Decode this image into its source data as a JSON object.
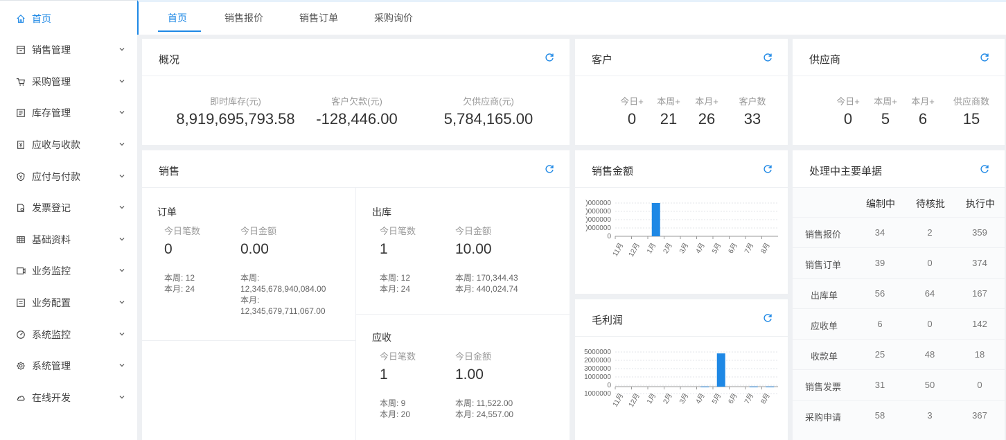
{
  "sidebar": {
    "items": [
      {
        "label": "首页",
        "icon": "home-icon"
      },
      {
        "label": "销售管理",
        "icon": "sales-icon"
      },
      {
        "label": "采购管理",
        "icon": "cart-icon"
      },
      {
        "label": "库存管理",
        "icon": "inventory-icon"
      },
      {
        "label": "应收与收款",
        "icon": "receivable-icon"
      },
      {
        "label": "应付与付款",
        "icon": "payable-icon"
      },
      {
        "label": "发票登记",
        "icon": "invoice-icon"
      },
      {
        "label": "基础资料",
        "icon": "grid-icon"
      },
      {
        "label": "业务监控",
        "icon": "monitor-icon"
      },
      {
        "label": "业务配置",
        "icon": "config-icon"
      },
      {
        "label": "系统监控",
        "icon": "gauge-icon"
      },
      {
        "label": "系统管理",
        "icon": "gear-icon"
      },
      {
        "label": "在线开发",
        "icon": "cloud-icon"
      }
    ]
  },
  "tabs": [
    "首页",
    "销售报价",
    "销售订单",
    "采购询价"
  ],
  "overview": {
    "title": "概况",
    "items": [
      {
        "label": "即时库存(元)",
        "value": "8,919,695,793.58"
      },
      {
        "label": "客户欠款(元)",
        "value": "-128,446.00"
      },
      {
        "label": "欠供应商(元)",
        "value": "5,784,165.00"
      }
    ]
  },
  "customer": {
    "title": "客户",
    "items": [
      {
        "label": "今日+",
        "value": "0"
      },
      {
        "label": "本周+",
        "value": "21"
      },
      {
        "label": "本月+",
        "value": "26"
      },
      {
        "label": "客户数",
        "value": "33"
      }
    ]
  },
  "supplier": {
    "title": "供应商",
    "items": [
      {
        "label": "今日+",
        "value": "0"
      },
      {
        "label": "本周+",
        "value": "5"
      },
      {
        "label": "本月+",
        "value": "6"
      },
      {
        "label": "供应商数",
        "value": "15"
      }
    ]
  },
  "sales": {
    "title": "销售",
    "order": {
      "title": "订单",
      "count_label": "今日笔数",
      "amount_label": "今日金额",
      "count": "0",
      "amount": "0.00",
      "week_count": "本周: 12",
      "month_count": "本月: 24",
      "week_amount_label": "本周:",
      "week_amount": "12,345,678,940,084.00",
      "month_amount_label": "本月:",
      "month_amount": "12,345,679,711,067.00"
    },
    "outbound": {
      "title": "出库",
      "count_label": "今日笔数",
      "amount_label": "今日金额",
      "count": "1",
      "amount": "10.00",
      "week_count": "本周: 12",
      "month_count": "本月: 24",
      "week_amount": "本周: 170,344.43",
      "month_amount": "本月: 440,024.74"
    },
    "receivable": {
      "title": "应收",
      "count_label": "今日笔数",
      "amount_label": "今日金额",
      "count": "1",
      "amount": "1.00",
      "week_count": "本周: 9",
      "month_count": "本月: 20",
      "week_amount": "本周: 11,522.00",
      "month_amount": "本月: 24,557.00"
    }
  },
  "pending": {
    "title": "处理中主要单据",
    "headers": [
      "编制中",
      "待核批",
      "执行中"
    ],
    "rows": [
      {
        "name": "销售报价",
        "v": [
          "34",
          "2",
          "359"
        ]
      },
      {
        "name": "销售订单",
        "v": [
          "39",
          "0",
          "374"
        ]
      },
      {
        "name": "出库单",
        "v": [
          "56",
          "64",
          "167"
        ]
      },
      {
        "name": "应收单",
        "v": [
          "6",
          "0",
          "142"
        ]
      },
      {
        "name": "收款单",
        "v": [
          "25",
          "48",
          "18"
        ]
      },
      {
        "name": "销售发票",
        "v": [
          "31",
          "50",
          "0"
        ]
      },
      {
        "name": "采购申请",
        "v": [
          "58",
          "3",
          "367"
        ]
      }
    ]
  },
  "chart_titles": {
    "sales_amount": "销售金额",
    "gross_profit": "毛利润"
  },
  "accent_color": "#1e88e5",
  "chart_data": [
    {
      "type": "bar",
      "title": "销售金额",
      "categories": [
        "11月",
        "12月",
        "1月",
        "2月",
        "3月",
        "4月",
        "5月",
        "6月",
        "7月",
        "8月"
      ],
      "values": [
        0,
        0,
        4000000,
        0,
        0,
        0,
        0,
        0,
        0,
        0
      ],
      "ytick_labels": [
        ")000000",
        ")000000",
        ")000000",
        ")000000",
        "0"
      ],
      "ylim": [
        0,
        4000000
      ],
      "grid": true
    },
    {
      "type": "bar",
      "title": "毛利润",
      "categories": [
        "11月",
        "12月",
        "1月",
        "2月",
        "3月",
        "4月",
        "5月",
        "6月",
        "7月",
        "8月"
      ],
      "values": [
        0,
        0,
        0,
        0,
        0,
        20000,
        4800000,
        0,
        20000,
        20000
      ],
      "ytick_labels": [
        "5000000",
        "2000000",
        "3000000",
        "1000000",
        "0",
        "1000000"
      ],
      "ylim": [
        -1000000,
        5000000
      ],
      "grid": true
    }
  ]
}
